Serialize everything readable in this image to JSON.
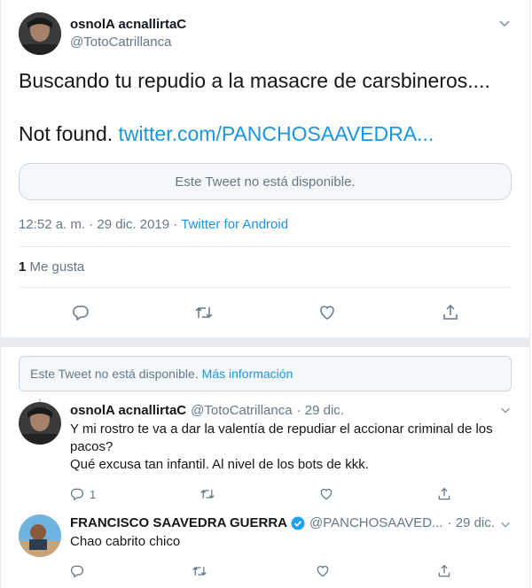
{
  "main_tweet": {
    "user_name": "osnolA acnallirtaC",
    "user_handle": "@TotoCatrillanca",
    "text_line1": "Buscando tu repudio a la masacre de carsbineros....",
    "text_line2_plain": "Not found.",
    "text_line2_link": "twitter.com/PANCHOSAAVEDRA...",
    "quoted_unavailable": "Este Tweet no está disponible.",
    "time": "12:52 a. m. · 29 dic. 2019 ·",
    "source": "Twitter for Android",
    "like_count": "1",
    "like_label": "Me gusta"
  },
  "thread": {
    "unavailable_text": "Este Tweet no está disponible.",
    "unavailable_link": "Más información",
    "reply1": {
      "user_name": "osnolA acnallirtaC",
      "user_handle": "@TotoCatrillanca",
      "time": "· 29 dic.",
      "text_line1": "Y mi rostro te va a dar la valentía de repudiar el accionar criminal de los pacos?",
      "text_line2": "Qué excusa tan infantil. Al nivel de los bots de kkk.",
      "reply_count": "1"
    },
    "reply2": {
      "user_name": "FRANCISCO SAAVEDRA GUERRA",
      "user_handle": "@PANCHOSAAVED...",
      "time": "· 29 dic.",
      "text": "Chao cabrito chico"
    }
  },
  "colors": {
    "link": "#1b95e0",
    "muted": "#657786",
    "border": "#e6ecf0",
    "verified": "#1da1f2"
  },
  "icons": [
    "chevron-down-icon",
    "reply-icon",
    "retweet-icon",
    "like-icon",
    "share-icon",
    "verified-badge-icon"
  ]
}
